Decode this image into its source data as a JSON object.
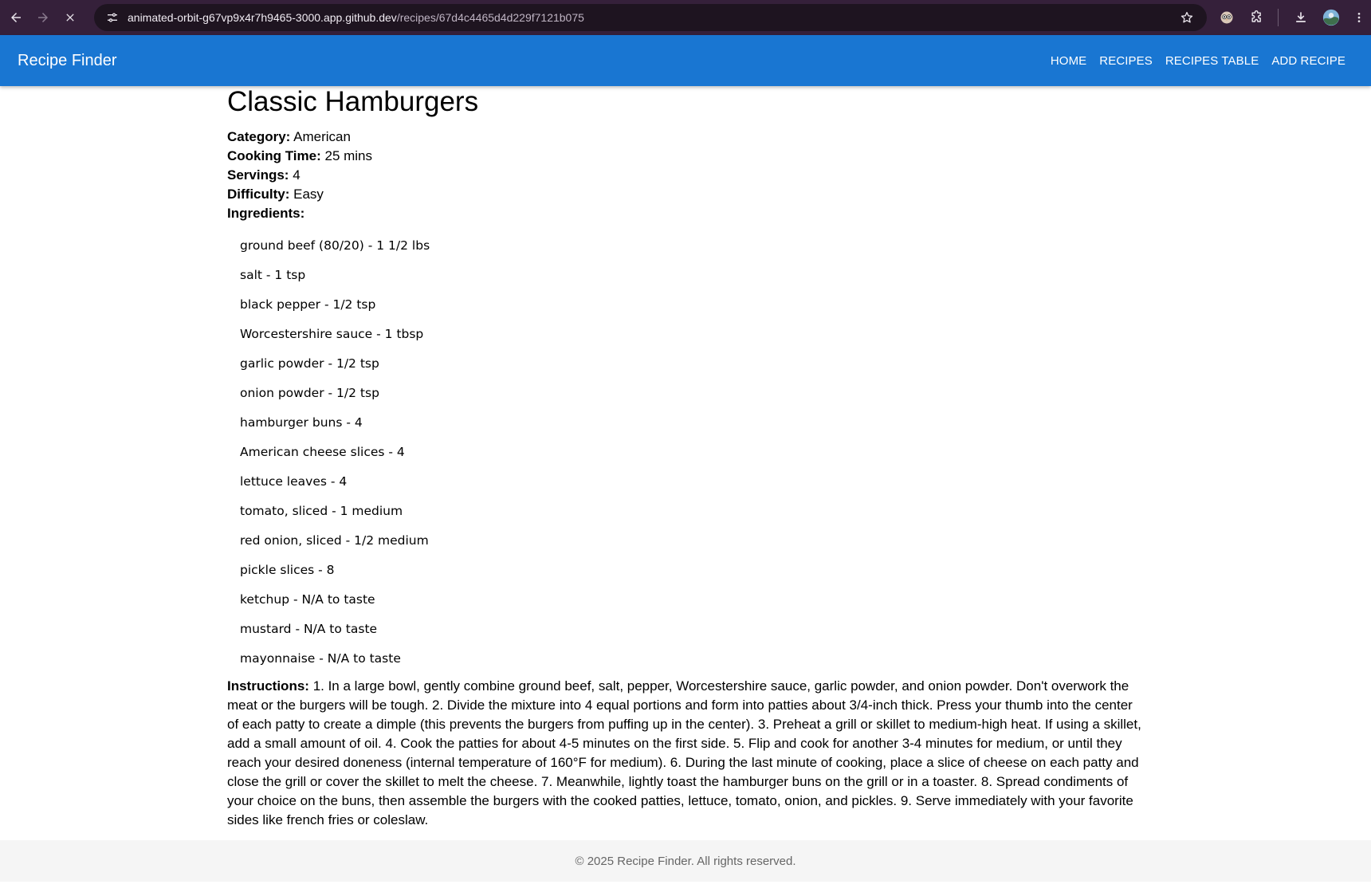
{
  "browser": {
    "url_host": "animated-orbit-g67vp9x4r7h9465-3000.app.github.dev",
    "url_path": "/recipes/67d4c4465d4d229f7121b075"
  },
  "app": {
    "brand": "Recipe Finder",
    "nav": [
      "HOME",
      "RECIPES",
      "RECIPES TABLE",
      "ADD RECIPE"
    ]
  },
  "recipe": {
    "title": "Classic Hamburgers",
    "category_label": "Category:",
    "category": "American",
    "time_label": "Cooking Time:",
    "time": "25 mins",
    "servings_label": "Servings:",
    "servings": "4",
    "difficulty_label": "Difficulty:",
    "difficulty": "Easy",
    "ingredients_label": "Ingredients:",
    "ingredients": [
      "ground beef (80/20) - 1 1/2 lbs",
      "salt - 1 tsp",
      "black pepper - 1/2 tsp",
      "Worcestershire sauce - 1 tbsp",
      "garlic powder - 1/2 tsp",
      "onion powder - 1/2 tsp",
      "hamburger buns - 4",
      "American cheese slices - 4",
      "lettuce leaves - 4",
      "tomato, sliced - 1 medium",
      "red onion, sliced - 1/2 medium",
      "pickle slices - 8",
      "ketchup - N/A to taste",
      "mustard - N/A to taste",
      "mayonnaise - N/A to taste"
    ],
    "instructions_label": "Instructions:",
    "instructions": "1. In a large bowl, gently combine ground beef, salt, pepper, Worcestershire sauce, garlic powder, and onion powder. Don't overwork the meat or the burgers will be tough. 2. Divide the mixture into 4 equal portions and form into patties about 3/4-inch thick. Press your thumb into the center of each patty to create a dimple (this prevents the burgers from puffing up in the center). 3. Preheat a grill or skillet to medium-high heat. If using a skillet, add a small amount of oil. 4. Cook the patties for about 4-5 minutes on the first side. 5. Flip and cook for another 3-4 minutes for medium, or until they reach your desired doneness (internal temperature of 160°F for medium). 6. During the last minute of cooking, place a slice of cheese on each patty and close the grill or cover the skillet to melt the cheese. 7. Meanwhile, lightly toast the hamburger buns on the grill or in a toaster. 8. Spread condiments of your choice on the buns, then assemble the burgers with the cooked patties, lettuce, tomato, onion, and pickles. 9. Serve immediately with your favorite sides like french fries or coleslaw."
  },
  "footer": {
    "text": "© 2025 Recipe Finder. All rights reserved."
  },
  "icons": {
    "back": "arrow-left-icon",
    "forward": "arrow-right-icon",
    "stop": "close-icon",
    "site_info": "tune-icon",
    "bookmark": "star-icon",
    "extension1": "owl-extension-icon",
    "extensions": "puzzle-icon",
    "download": "download-icon",
    "profile": "avatar",
    "menu": "kebab-menu-icon"
  },
  "colors": {
    "appbar": "#1976d2",
    "browser_frame": "#35203a",
    "footer_bg": "#f5f5f5"
  }
}
